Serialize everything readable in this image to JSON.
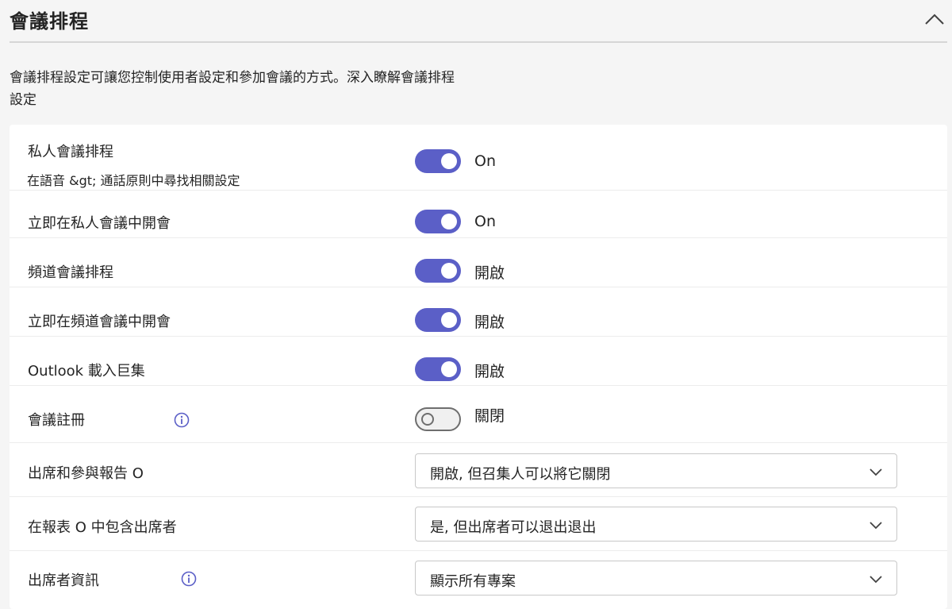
{
  "section": {
    "title": "會議排程",
    "collapse_icon": "chevron-up-icon"
  },
  "description": {
    "line1": "會議排程設定可讓您控制使用者設定和參加會議的方式。深入瞭解會議排程",
    "line2": "設定"
  },
  "settings": {
    "private_scheduling": {
      "label": "私人會議排程",
      "sublabel": "在語音 &gt; 通話原則中尋找相關設定",
      "state": "On",
      "on": true
    },
    "meet_now_private": {
      "label": "立即在私人會議中開會",
      "state": "On",
      "on": true
    },
    "channel_scheduling": {
      "label": "頻道會議排程",
      "state": "開啟",
      "on": true
    },
    "meet_now_channel": {
      "label": "立即在頻道會議中開會",
      "state": "開啟",
      "on": true
    },
    "outlook_addin": {
      "label": "Outlook 載入巨集",
      "state": "開啟",
      "on": true
    },
    "meeting_registration": {
      "label": "會議註冊",
      "state": "關閉",
      "on": false,
      "info_icon": "info-icon"
    },
    "attendance_report": {
      "label": "出席和參與報告 O",
      "value": "開啟, 但召集人可以將它關閉"
    },
    "include_attendees": {
      "label": "在報表 O 中包含出席者",
      "value": "是, 但出席者可以退出退出"
    },
    "attendee_info": {
      "label": "出席者資訊",
      "value": "顯示所有專案",
      "info_icon": "info-icon"
    }
  },
  "colors": {
    "accent": "#5b5fc7",
    "info_icon": "#5b5fc7",
    "background": "#f5f5f5",
    "panel": "#ffffff"
  }
}
